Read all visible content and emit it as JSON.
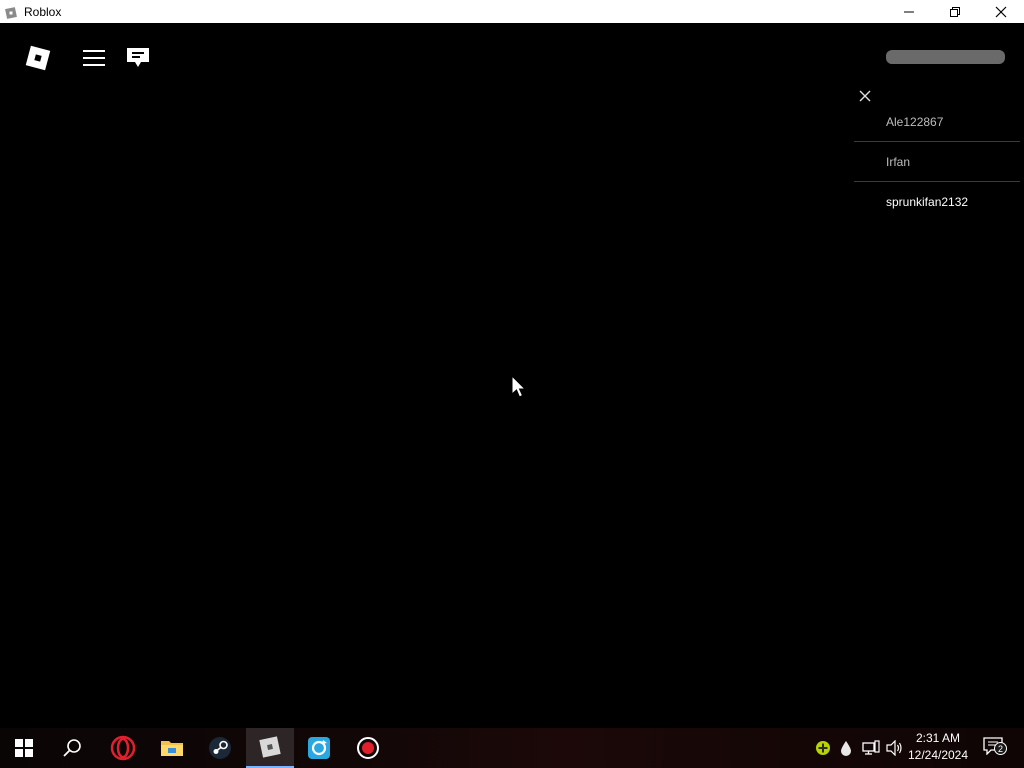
{
  "window": {
    "title": "Roblox",
    "controls": [
      "minimize",
      "restore",
      "close"
    ]
  },
  "game": {
    "top_icons": [
      "roblox-logo-icon",
      "menu-icon",
      "chat-icon"
    ],
    "player_list": {
      "players": [
        {
          "name": "Ale122867",
          "is_self": false
        },
        {
          "name": "Irfan",
          "is_self": false
        },
        {
          "name": "sprunkifan2132",
          "is_self": true
        }
      ]
    }
  },
  "taskbar": {
    "apps": [
      "start",
      "search",
      "opera",
      "file-explorer",
      "steam",
      "roblox",
      "app-sync",
      "recorder"
    ],
    "active_app": "roblox",
    "clock": {
      "time": "2:31 AM",
      "date": "12/24/2024"
    },
    "notifications_count": "2"
  },
  "colors": {
    "background": "#000000",
    "titlebar": "#ffffff",
    "player_text": "#bdbdbd",
    "self_text": "#ffffff",
    "accent": "#7ab4ff"
  }
}
